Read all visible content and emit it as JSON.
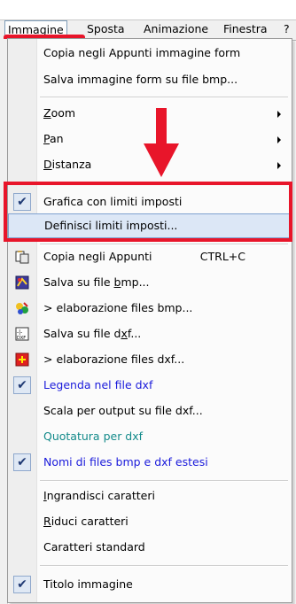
{
  "menubar": {
    "items": [
      "Immagine",
      "Sposta",
      "Animazione",
      "Finestra",
      "?"
    ]
  },
  "menu": {
    "copy_image": "Copia negli Appunti immagine form",
    "save_bmp_form": "Salva immagine form su file bmp...",
    "zoom": {
      "pre": "",
      "u": "Z",
      "post": "oom"
    },
    "pan": {
      "pre": "",
      "u": "P",
      "post": "an"
    },
    "distanza": {
      "pre": "",
      "u": "D",
      "post": "istanza"
    },
    "grafica_limiti": "Grafica con limiti imposti",
    "definisci_limiti": "Definisci limiti imposti...",
    "copia_appunti": "Copia negli Appunti",
    "copia_shortcut": "CTRL+C",
    "salva_bmp": {
      "pre": "Salva su file ",
      "u": "b",
      "post": "mp..."
    },
    "elab_bmp": ">   elaborazione files bmp...",
    "salva_dxf": {
      "pre": "Salva su file d",
      "u": "x",
      "post": "f..."
    },
    "elab_dxf": ">   elaborazione files dxf...",
    "legenda": "Legenda nel file dxf",
    "scala": "Scala per output su file dxf...",
    "quotatura": "Quotatura per dxf",
    "nomi_files": "Nomi di files bmp e dxf estesi",
    "ingrandisci": {
      "pre": "",
      "u": "I",
      "post": "ngrandisci caratteri"
    },
    "riduci": {
      "pre": "",
      "u": "R",
      "post": "iduci caratteri"
    },
    "standard": "Caratteri standard",
    "titolo": "Titolo immagine"
  },
  "colors": {
    "annotation_red": "#e8152a",
    "highlight": "#dce7f6",
    "blue_text": "#1a1adb",
    "teal_text": "#138a8a"
  },
  "icons": [
    "checkmark-icon",
    "copy-clipboard-icon",
    "save-bmp-icon",
    "process-bmp-icon",
    "save-dxf-icon",
    "process-dxf-icon",
    "submenu-arrow-icon",
    "red-down-arrow-icon"
  ]
}
